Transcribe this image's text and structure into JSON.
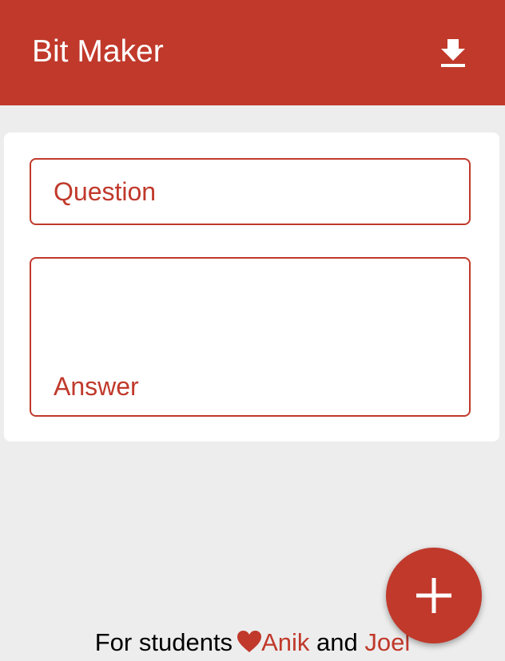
{
  "header": {
    "title": "Bit Maker",
    "download_icon": "download-icon"
  },
  "form": {
    "question_placeholder": "Question",
    "answer_placeholder": "Answer"
  },
  "footer": {
    "prefix": "For students",
    "heart_icon": "heart-icon",
    "author1": "Anik",
    "conjunction": "and",
    "author2": "Joel"
  },
  "fab": {
    "icon": "plus-icon"
  },
  "colors": {
    "accent": "#c0392b",
    "background": "#ededed",
    "card": "#ffffff"
  }
}
